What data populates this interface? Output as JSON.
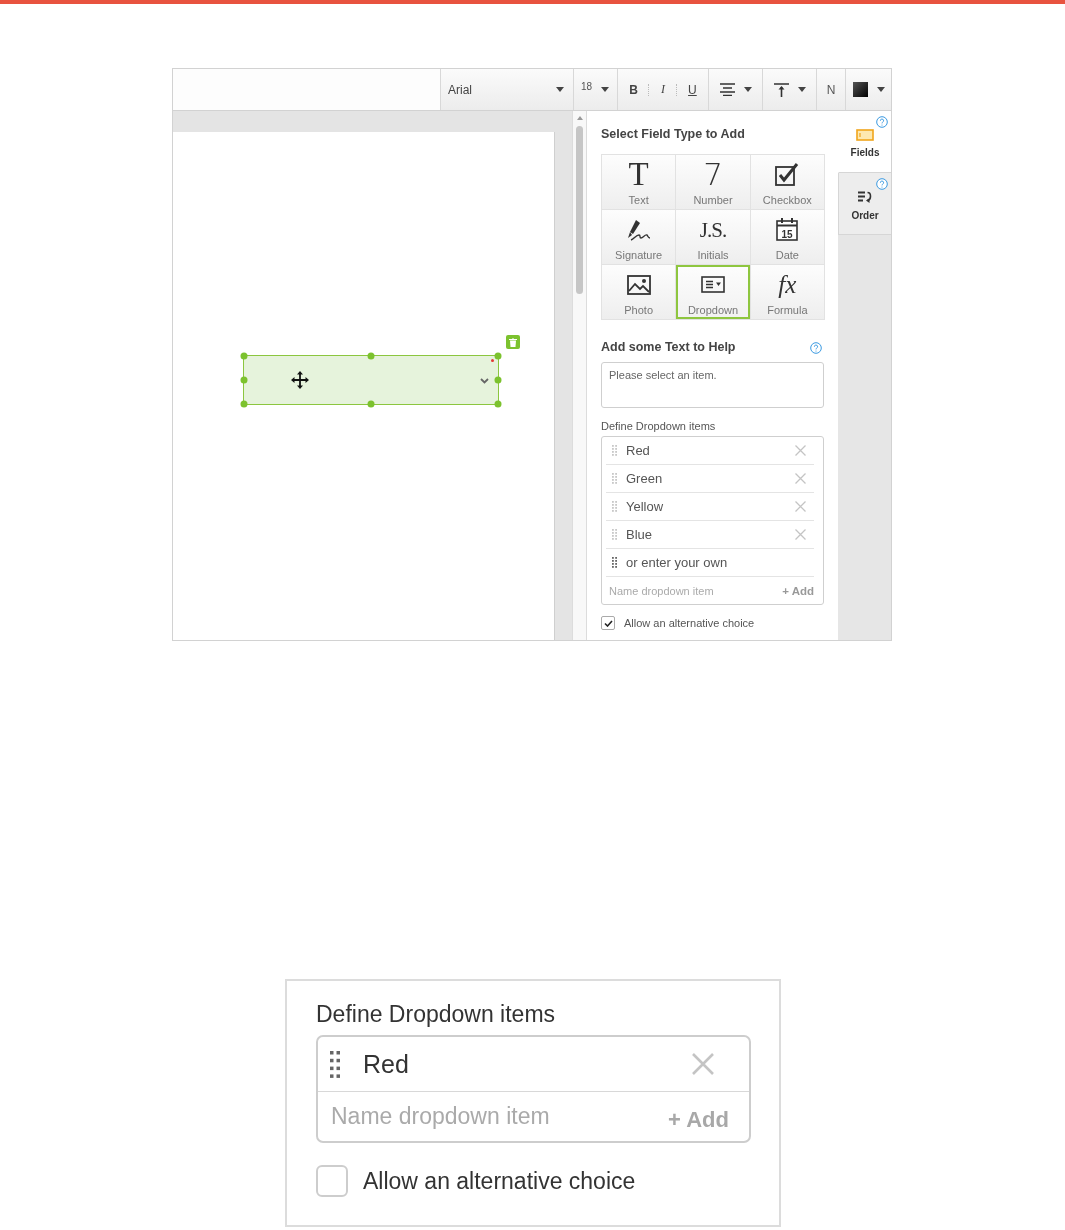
{
  "toolbar": {
    "font": {
      "value": "Arial"
    },
    "size": {
      "value": "18"
    },
    "style_buttons": [
      {
        "label": "B",
        "kind": "bold"
      },
      {
        "label": "I",
        "kind": "italic"
      },
      {
        "label": "U",
        "kind": "underline"
      }
    ],
    "text_button": {
      "label": "N"
    }
  },
  "canvas": {
    "field": {
      "kind": "dropdown",
      "selected": true,
      "required": true
    }
  },
  "panel": {
    "field_types": {
      "title": "Select Field Type to Add",
      "items": [
        {
          "kind": "text",
          "glyph": "T",
          "label": "Text",
          "selected": false
        },
        {
          "kind": "number",
          "glyph": "7",
          "label": "Number",
          "selected": false
        },
        {
          "kind": "checkbox",
          "label": "Checkbox",
          "selected": false
        },
        {
          "kind": "signature",
          "label": "Signature",
          "selected": false
        },
        {
          "kind": "initials",
          "glyph": "J.S.",
          "label": "Initials",
          "selected": false
        },
        {
          "kind": "date",
          "glyph": "15",
          "label": "Date",
          "selected": false
        },
        {
          "kind": "photo",
          "label": "Photo",
          "selected": false
        },
        {
          "kind": "dropdown",
          "label": "Dropdown",
          "selected": true
        },
        {
          "kind": "formula",
          "glyph": "fx",
          "label": "Formula",
          "selected": false
        }
      ]
    },
    "help_text": {
      "title": "Add some Text to Help",
      "value": "Please select an item."
    },
    "dropdown_items": {
      "title": "Define Dropdown items",
      "items": [
        {
          "label": "Red"
        },
        {
          "label": "Green"
        },
        {
          "label": "Yellow"
        },
        {
          "label": "Blue"
        }
      ],
      "custom_option": "or enter your own",
      "new_item": {
        "placeholder": "Name dropdown item"
      },
      "add_button": "+ Add"
    },
    "alternative_choice": {
      "label": "Allow an alternative choice",
      "checked": true
    }
  },
  "side_tabs": [
    {
      "kind": "fields",
      "label": "Fields",
      "selected": true
    },
    {
      "kind": "order",
      "label": "Order",
      "selected": false
    }
  ],
  "inset": {
    "title": "Define Dropdown items",
    "items": [
      {
        "label": "Red"
      }
    ],
    "new_item": {
      "placeholder": "Name dropdown item"
    },
    "add_button": "+ Add",
    "alternative_choice": {
      "label": "Allow an alternative choice",
      "checked": false
    }
  }
}
